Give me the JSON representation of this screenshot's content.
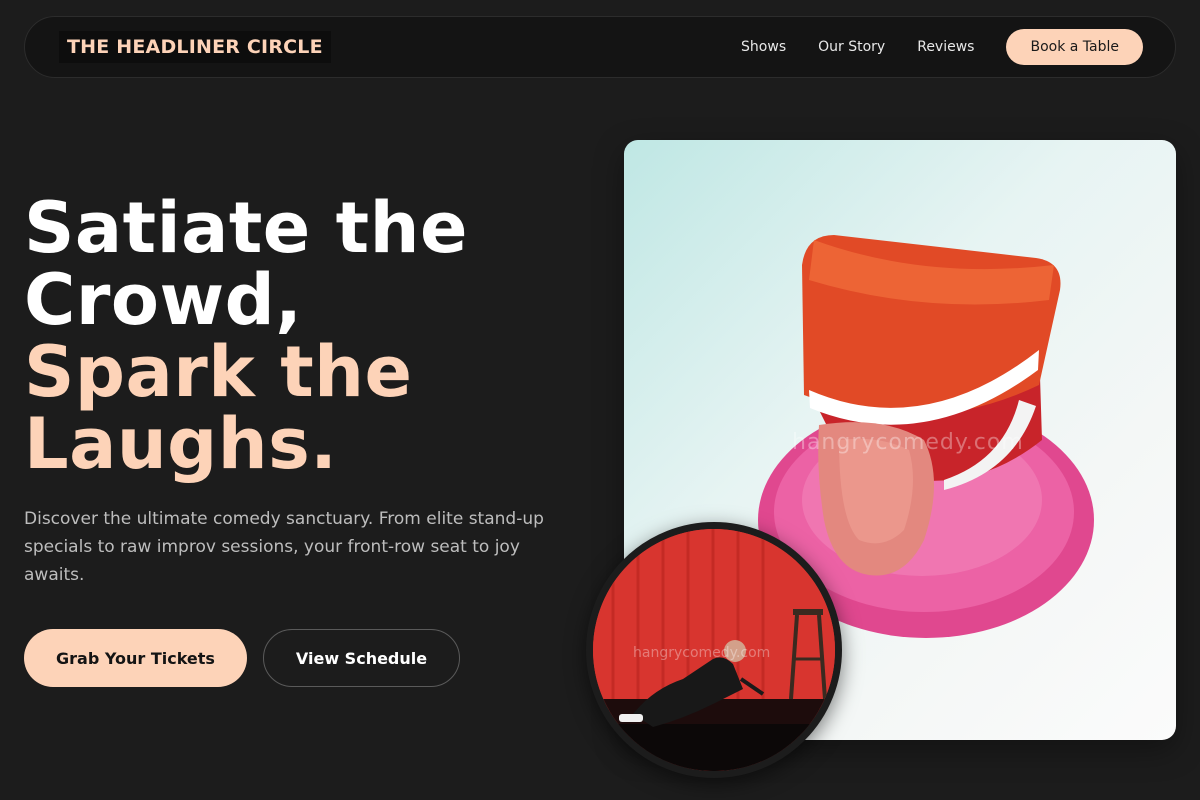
{
  "header": {
    "logo_text": "THE HEADLINER CIRCLE",
    "nav": [
      {
        "label": "Shows"
      },
      {
        "label": "Our Story"
      },
      {
        "label": "Reviews"
      }
    ],
    "cta_label": "Book a Table"
  },
  "hero": {
    "headline_line1": "Satiate the",
    "headline_line2": "Crowd,",
    "headline_line3": "Spark the",
    "headline_line4": "Laughs.",
    "description": "Discover the ultimate comedy sanctuary. From elite stand-up specials to raw improv sessions, your front-row seat to joy awaits.",
    "primary_button": "Grab Your Tickets",
    "secondary_button": "View Schedule"
  },
  "images": {
    "main_watermark": "hangrycomedy.com",
    "circle_watermark": "hangrycomedy.com"
  },
  "colors": {
    "background": "#1c1c1c",
    "accent": "#fdd3b8",
    "text_muted": "#bdbdbd"
  }
}
